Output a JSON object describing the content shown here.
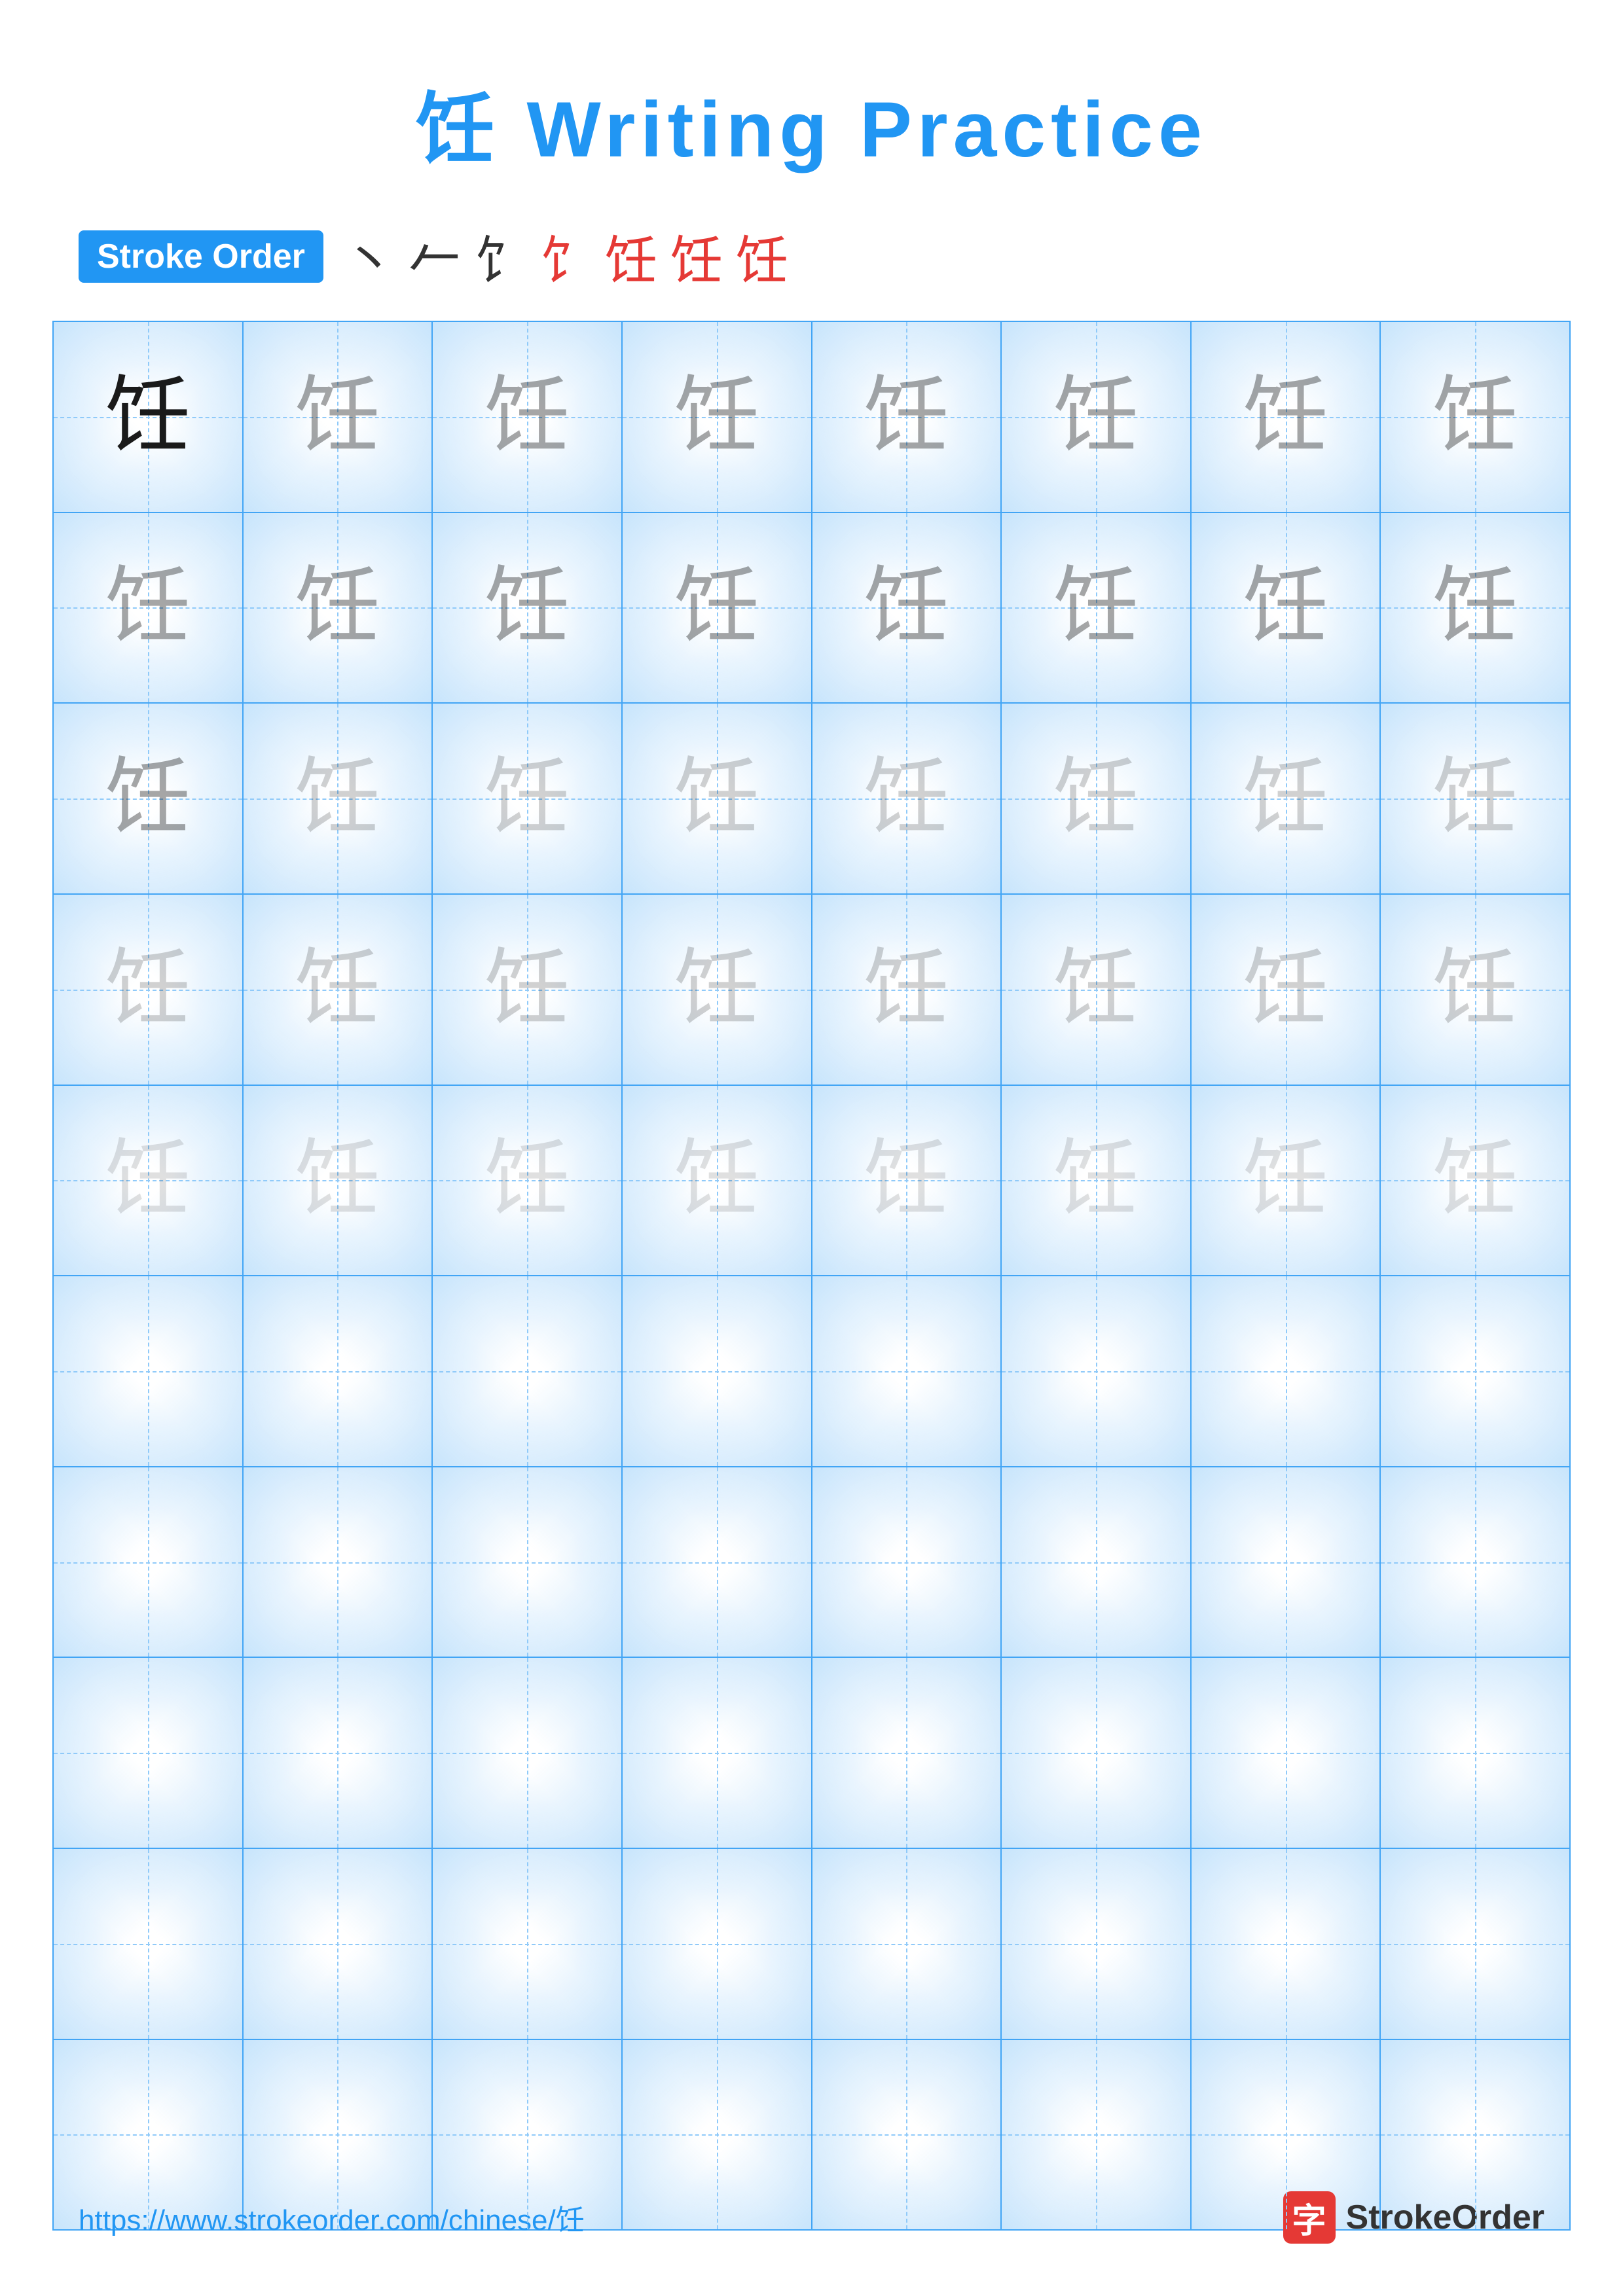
{
  "title": {
    "character": "饪",
    "text": "Writing Practice",
    "full": "饪 Writing Practice"
  },
  "stroke_order": {
    "badge_label": "Stroke Order",
    "strokes": [
      "丶",
      "ノ",
      "饣",
      "饣",
      "饪-5",
      "饪-6",
      "饪"
    ]
  },
  "grid": {
    "rows": 10,
    "cols": 8,
    "character": "饪",
    "practice_rows_with_char": 5,
    "empty_rows": 5
  },
  "footer": {
    "url": "https://www.strokeorder.com/chinese/饪",
    "logo_char": "字",
    "logo_label": "StrokeOrder"
  },
  "colors": {
    "primary_blue": "#2196F3",
    "red": "#e53935",
    "grid_line": "#42A5F5",
    "guide_line": "#90CAF9"
  }
}
